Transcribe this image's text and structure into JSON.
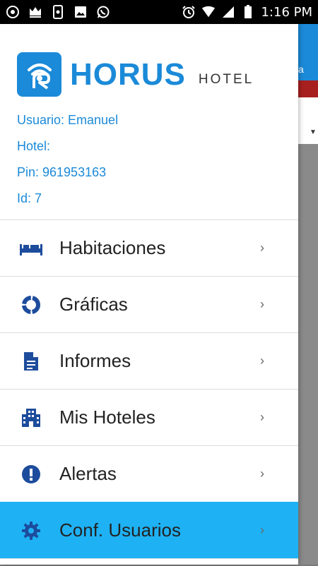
{
  "status_bar": {
    "time": "1:16 PM",
    "left_icons": [
      "chrome-icon",
      "crown-icon",
      "phone-app-icon",
      "image-icon",
      "whatsapp-icon"
    ],
    "right_icons": [
      "alarm-icon",
      "wifi-icon",
      "signal-icon",
      "battery-icon"
    ]
  },
  "background_app": {
    "header_fragment": "a",
    "accent": "#1b8ad8",
    "bar_color": "#a81f1f"
  },
  "drawer": {
    "logo": {
      "word": "HORUS",
      "sub": "HOTEL",
      "color": "#1b8ad8"
    },
    "user_info": {
      "usuario": "Usuario: Emanuel",
      "hotel": "Hotel:",
      "pin": "Pin: 961953163",
      "id": "Id: 7"
    },
    "menu": [
      {
        "label": "Habitaciones",
        "icon": "bed-icon",
        "active": false
      },
      {
        "label": "Gráficas",
        "icon": "donut-chart-icon",
        "active": false
      },
      {
        "label": "Informes",
        "icon": "document-icon",
        "active": false
      },
      {
        "label": "Mis Hoteles",
        "icon": "building-icon",
        "active": false
      },
      {
        "label": "Alertas",
        "icon": "alert-icon",
        "active": false
      },
      {
        "label": "Conf. Usuarios",
        "icon": "gear-icon",
        "active": true
      }
    ],
    "chevron": "›",
    "active_color": "#1eb2f5"
  }
}
